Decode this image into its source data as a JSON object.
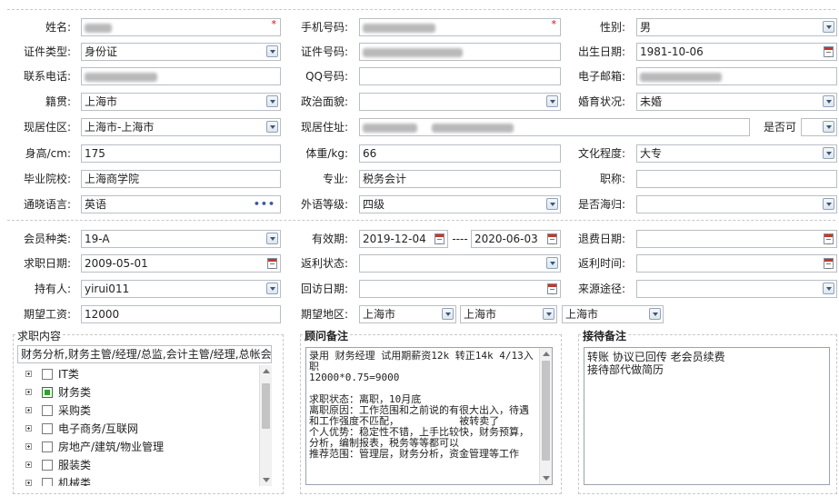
{
  "labels": {
    "name": "姓名:",
    "phone": "手机号码:",
    "gender": "性别:",
    "id_type": "证件类型:",
    "id_no": "证件号码:",
    "birth": "出生日期:",
    "contact": "联系电话:",
    "qq": "QQ号码:",
    "email": "电子邮箱:",
    "native": "籍贯:",
    "political": "政治面貌:",
    "marital": "婚育状况:",
    "cur_area": "现居住区:",
    "cur_addr": "现居住址:",
    "whether": "是否可",
    "height": "身高/cm:",
    "weight": "体重/kg:",
    "education": "文化程度:",
    "school": "毕业院校:",
    "major": "专业:",
    "title": "职称:",
    "language": "通晓语言:",
    "lang_level": "外语等级:",
    "overseas": "是否海归:",
    "member_type": "会员种类:",
    "validity": "有效期:",
    "refund_date": "退费日期:",
    "job_date": "求职日期:",
    "rebate_status": "返利状态:",
    "rebate_time": "返利时间:",
    "holder": "持有人:",
    "visit_date": "回访日期:",
    "source": "来源途径:",
    "salary": "期望工资:",
    "region": "期望地区:"
  },
  "values": {
    "gender": "男",
    "id_type": "身份证",
    "birth": "1981-10-06",
    "native": "上海市",
    "marital": "未婚",
    "cur_area": "上海市-上海市",
    "height": "175",
    "weight": "66",
    "education": "大专",
    "school": "上海商学院",
    "major": "税务会计",
    "language": "英语",
    "lang_level": "四级",
    "member_type": "19-A",
    "valid_from": "2019-12-04",
    "valid_sep": "----",
    "valid_to": "2020-06-03",
    "job_date": "2009-05-01",
    "holder": "yirui011",
    "salary": "12000",
    "region1": "上海市",
    "region2": "上海市",
    "region3": "上海市"
  },
  "job_panel": {
    "title": "求职内容",
    "summary": "财务分析,财务主管/经理/总监,会计主管/经理,总帐会",
    "tree": [
      {
        "label": "IT类",
        "checked": false
      },
      {
        "label": "财务类",
        "checked": true
      },
      {
        "label": "采购类",
        "checked": false
      },
      {
        "label": "电子商务/互联网",
        "checked": false
      },
      {
        "label": "房地产/建筑/物业管理",
        "checked": false
      },
      {
        "label": "服装类",
        "checked": false
      },
      {
        "label": "机械类",
        "checked": false
      }
    ]
  },
  "consultant_panel": {
    "title": "顾问备注",
    "text": "录用 财务经理 试用期薪资12k 转正14k 4/13入职\n12000*0.75=9000\n\n求职状态：离职，10月底\n离职原因：工作范围和之前说的有很大出入，待遇和工作强度不匹配，          被转卖了\n个人优势：稳定性不错，上手比较快，财务预算，分析，编制报表，税务等等都可以\n推荐范围：管理层，财务分析，资金管理等工作"
  },
  "reception_panel": {
    "title": "接待备注",
    "text": "转账 协议已回传 老会员续费\n接待部代做简历"
  }
}
